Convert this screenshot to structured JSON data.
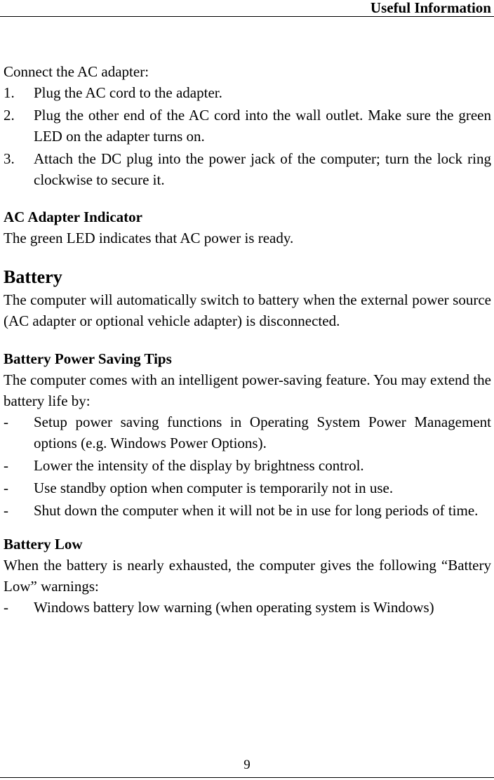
{
  "header": {
    "title": "Useful Information"
  },
  "footer": {
    "page_number": "9"
  },
  "sections": {
    "connect": {
      "intro": "Connect the AC adapter:",
      "steps": [
        {
          "marker": "1.",
          "text": "Plug the AC cord to the adapter."
        },
        {
          "marker": "2.",
          "text": "Plug the other end of the AC cord into the wall outlet. Make sure the green LED on the adapter turns on."
        },
        {
          "marker": "3.",
          "text": "Attach the DC plug into the power jack of the computer; turn the lock ring clockwise to secure it."
        }
      ]
    },
    "ac_indicator": {
      "heading": "AC Adapter Indicator",
      "body": "The green LED indicates that AC power is ready."
    },
    "battery": {
      "heading": "Battery",
      "body": "The computer will automatically switch to battery when the external power source (AC adapter or optional vehicle adapter) is disconnected."
    },
    "power_saving": {
      "heading": "Battery Power Saving Tips",
      "body": "The computer comes with an intelligent power-saving feature. You may extend the battery life by:",
      "tips": [
        {
          "marker": "-",
          "text": "Setup power saving functions in Operating System Power Management options (e.g. Windows Power Options)."
        },
        {
          "marker": "-",
          "text": "Lower the intensity of the display by brightness control."
        },
        {
          "marker": "-",
          "text": "Use standby option when computer is temporarily not in use."
        },
        {
          "marker": "-",
          "text": "Shut down the computer when it will not be in use for long periods of time."
        }
      ]
    },
    "battery_low": {
      "heading": "Battery Low",
      "body": "When the battery is nearly exhausted, the computer gives the following “Battery Low” warnings:",
      "warnings": [
        {
          "marker": "-",
          "text": "Windows battery low warning (when operating system is Windows)"
        }
      ]
    }
  }
}
